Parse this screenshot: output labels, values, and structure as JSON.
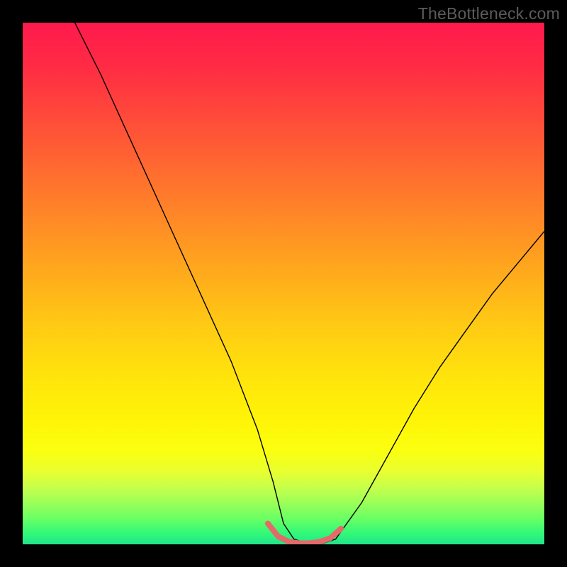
{
  "watermark": "TheBottleneck.com",
  "chart_data": {
    "type": "line",
    "title": "",
    "xlabel": "",
    "ylabel": "",
    "xlim": [
      0,
      100
    ],
    "ylim": [
      0,
      100
    ],
    "grid": false,
    "legend": false,
    "background_gradient": {
      "stops": [
        {
          "pos": 0.0,
          "color": "#ff1a4d"
        },
        {
          "pos": 0.5,
          "color": "#ffc010"
        },
        {
          "pos": 0.8,
          "color": "#fff407"
        },
        {
          "pos": 1.0,
          "color": "#22e48a"
        }
      ]
    },
    "series": [
      {
        "name": "bottleneck-curve",
        "color": "#000000",
        "width": 1.4,
        "x": [
          10,
          15,
          20,
          25,
          30,
          35,
          40,
          45,
          48,
          50,
          52,
          55,
          57,
          60,
          65,
          70,
          75,
          80,
          85,
          90,
          95,
          100
        ],
        "y": [
          100,
          90,
          79,
          68,
          57,
          46,
          35,
          22,
          12,
          4,
          1,
          0,
          0,
          1,
          8,
          17,
          26,
          34,
          41,
          48,
          54,
          60
        ]
      },
      {
        "name": "optimal-band",
        "color": "#e46a6a",
        "width": 8,
        "x": [
          47,
          49,
          51,
          53,
          55,
          57,
          59,
          61
        ],
        "y": [
          4,
          1.5,
          0.5,
          0.2,
          0.2,
          0.5,
          1.2,
          3
        ]
      }
    ]
  }
}
